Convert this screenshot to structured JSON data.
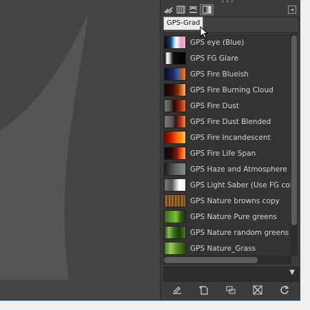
{
  "tooltip": {
    "text": "GPS-Grad"
  },
  "dock": {
    "tabs": [
      {
        "icon": "brushes-icon"
      },
      {
        "icon": "patterns-icon"
      },
      {
        "icon": "fonts-icon"
      },
      {
        "icon": "gradients-icon",
        "active": true
      }
    ],
    "tab_menu_icon": "tab-menu-icon"
  },
  "gradients": {
    "items": [
      {
        "label": "GPS eye (Blue)",
        "swatch": "linear-gradient(90deg,#0a0a0a 0%,#1b3a6a 30%,#7ac6ff 45%,#ffffff 55%,#d9a0c8 80%,#ffb0c8 100%)"
      },
      {
        "label": "GPS FG Glare",
        "swatch": "linear-gradient(90deg,#000 0%,#fff 12%,#ccc 22%,#111 40%,#000 100%)"
      },
      {
        "label": "GPS Fire Blueish",
        "swatch": "linear-gradient(90deg,#0b0f2a 0%,#1d2f66 45%,#3a5fa0 65%,#d25a10 85%,#f08a20 100%)"
      },
      {
        "label": "GPS Fire Burning Cloud",
        "swatch": "linear-gradient(90deg,#150500 0%,#3a0f05 40%,#8a2a08 65%,#e07a2a 85%,#f6c070 100%)"
      },
      {
        "label": "GPS Fire Dust",
        "swatch": "linear-gradient(90deg,#777 0%,#555 25%,#2a0606 45%,#8a1a10 70%,#ff6a20 100%)"
      },
      {
        "label": "GPS Fire Dust Blended",
        "swatch": "linear-gradient(90deg,#7a7a7a 0%,#5a5a5a 35%,#3a1010 55%,#c23a18 80%,#ff8a30 100%)"
      },
      {
        "label": "GPS Fire Incandescent",
        "swatch": "linear-gradient(90deg,#7a0000 0%,#c21a00 30%,#ff5a00 55%,#ff9a10 80%,#ffd060 100%)"
      },
      {
        "label": "GPS Fire Life Span",
        "swatch": "linear-gradient(90deg,#0a0a0a 0%,#2a0a0a 35%,#8a1a00 60%,#ff5010 80%,#ffb060 100%)"
      },
      {
        "label": "GPS Haze and Atmosphere",
        "swatch": "linear-gradient(90deg,#1a1a1a 0%,#454545 30%,#6a6a6a 60%,#8a8a8a 100%)"
      },
      {
        "label": "GPS Light Saber (Use FG color)",
        "swatch": "linear-gradient(90deg,#777 0%,#555 35%,#bbb 55%,#fff 70%,#f0f0f0 100%)"
      },
      {
        "label": "GPS Nature browns copy",
        "swatch": "repeating-linear-gradient(90deg,#6a4010 0px,#b07a30 3px,#3a2008 5px,#c08a40 7px,#5a3010 9px)"
      },
      {
        "label": "GPS Nature Pure greens",
        "swatch": "linear-gradient(90deg,#3a6a1a 0%,#5a9a2a 30%,#7ac03a 55%,#2a5a10 80%,#1a3a08 100%)"
      },
      {
        "label": "GPS Nature random greens",
        "swatch": "linear-gradient(90deg,#2a4a10 0%,#8ac04a 20%,#3a6a1a 45%,#1a3a08 70%,#4a7a20 100%)"
      },
      {
        "label": "GPS Nature_Grass",
        "swatch": "linear-gradient(90deg,#4a7a20 0%,#9ac85a 30%,#5a8a2a 60%,#2a4a10 100%)"
      }
    ],
    "filter_value": "",
    "combo_value": ""
  },
  "actions": [
    {
      "icon": "edit-gradient-icon"
    },
    {
      "icon": "new-gradient-icon"
    },
    {
      "icon": "duplicate-gradient-icon"
    },
    {
      "icon": "delete-gradient-icon"
    },
    {
      "icon": "refresh-gradients-icon"
    }
  ],
  "colors": {
    "canvas_bg": "#444444",
    "canvas_shape": "#555555",
    "dock_bg": "#3c3c3c",
    "list_bg": "#333333",
    "text": "#d6d6d6",
    "tooltip_bg": "#ececec",
    "window_border": "#6aa0d8"
  }
}
